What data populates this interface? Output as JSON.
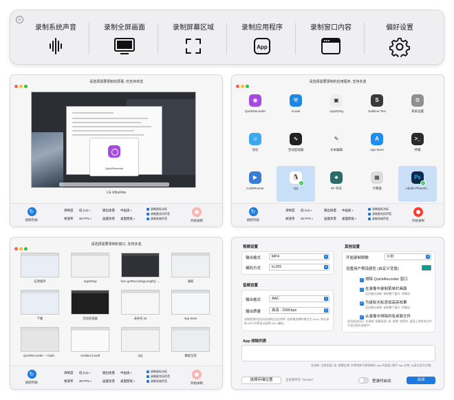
{
  "toolbar": {
    "items": [
      {
        "label": "录制系统声音",
        "icon": "waveform-icon"
      },
      {
        "label": "录制全屏画面",
        "icon": "monitor-icon"
      },
      {
        "label": "录制屏幕区域",
        "icon": "crop-frame-icon"
      },
      {
        "label": "录制应用程序",
        "icon": "app-icon",
        "icon_text": "App"
      },
      {
        "label": "录制窗口内容",
        "icon": "window-icon"
      },
      {
        "label": "偏好设置",
        "icon": "gear-icon"
      }
    ]
  },
  "controls": {
    "refresh": "刷新列表",
    "res_label": "清晰度",
    "res_value": "低 (1x)",
    "fps_label": "帧速率",
    "fps_value": "30 FPS",
    "quality_label": "输出质量",
    "quality_value": "中画质",
    "format_label": "画面背景",
    "format_value": "桌面壁纸",
    "checks": [
      "录制鼠标光标",
      "录制麦克风声音",
      "录制系统声音"
    ],
    "record": "开始录制"
  },
  "screen_window": {
    "title": "请选择需要录制的屏幕, 仅支持单选",
    "screen_name": "LG UltraFine",
    "app_name": "QuickRecorder"
  },
  "app_window": {
    "title": "请选择需要录制的应用程序, 支持多选",
    "apps": [
      {
        "name": "QuickRecorder",
        "color": "#a64be0",
        "glyph": "◉"
      },
      {
        "name": "Xcode",
        "color": "#1e88e5",
        "glyph": "⚒"
      },
      {
        "name": "App2Dmg",
        "color": "#eeeeee",
        "glyph": "▣"
      },
      {
        "name": "Sublime Text",
        "color": "#3a3a3a",
        "glyph": "S"
      },
      {
        "name": "系统设置",
        "color": "#8e8e93",
        "glyph": "⚙"
      },
      {
        "name": "访达",
        "color": "#3ba8f0",
        "glyph": "☺"
      },
      {
        "name": "活动监视器",
        "color": "#222222",
        "glyph": "∿"
      },
      {
        "name": "文本编辑",
        "color": "#f5f5f5",
        "glyph": "✎"
      },
      {
        "name": "App Store",
        "color": "#1f8cf0",
        "glyph": "A"
      },
      {
        "name": "终端",
        "color": "#2b2b2b",
        "glyph": ">_"
      },
      {
        "name": "CodeRunner",
        "color": "#3a7bd5",
        "glyph": "▶"
      },
      {
        "name": "QQ",
        "color": "#ffffff",
        "glyph": "🐧"
      },
      {
        "name": "SF 符号",
        "color": "#2d6a6a",
        "glyph": "♣"
      },
      {
        "name": "计算器",
        "color": "#dcdcdc",
        "glyph": "▦"
      },
      {
        "name": "Adobe Photosh...",
        "color": "#0b2a4a",
        "glyph": "Ps"
      }
    ]
  },
  "window_window": {
    "title": "请选择需要录制的窗口, 支持多选",
    "windows": [
      {
        "name": "应用程序"
      },
      {
        "name": "App2Dmg"
      },
      {
        "name": "func getRecordingLength() -..."
      },
      {
        "name": "通知"
      },
      {
        "name": "下载"
      },
      {
        "name": "活动监视器"
      },
      {
        "name": "未命名.txt"
      },
      {
        "name": "App Store"
      },
      {
        "name": "QuickRecorder — build..."
      },
      {
        "name": "Untitled 3.swift"
      },
      {
        "name": "QQ"
      },
      {
        "name": "模板全部"
      }
    ]
  },
  "settings": {
    "video_title": "视频设置",
    "output_format_label": "输出格式",
    "output_format_value": "MP4",
    "encoder_label": "编码方式",
    "encoder_value": "H.265",
    "audio_title": "音频设置",
    "audio_format_label": "输出格式",
    "audio_format_value": "AAC",
    "audio_quality_label": "输出质量",
    "audio_quality_value": "高清 - 256Kbps",
    "audio_hint": "录制视频时会自动选择适当比特率, 但如果选择的格式为 Opus, 则在录制 MP4 时将自动选择 AAC 编码。",
    "other_title": "其他设置",
    "countdown_label": "开始录制倒数",
    "countdown_value": "0 秒",
    "bg_color_label": "设置用户预设颜色 (自定义背景)",
    "exclude_self": "排除 QuickRecorder 窗口",
    "show_menubar": "在录像中录制菜单栏画面",
    "show_menubar_hint": "这仅能在录制 \"录制整个窗口\" 的情况",
    "hide_highlight": "为鼠标光标添加高亮效果",
    "hide_highlight_hint": "这仅能在录制 \"录制整个窗口\" 的情况",
    "hide_desktop": "从录像中排除所有桌面文件",
    "hide_desktop_hint": "启用此选项后, 在录制 \"屏幕画面\" 或 \"录制\" 程序时, 桌面上的所有文件不会出现在录像中。",
    "exclude_title": "App 排除列表",
    "exclude_hint": "在录制 \"全屏画面\" 或 \"屏幕区域\" 时将排除不想录制的 App 的画面 (填写 App 名称, 以英文逗号分隔)",
    "save_btn": "选择存储位置",
    "save_path": "当前保存在 \"Movies\"",
    "launch_login": "登录时启动",
    "close_btn": "关闭"
  },
  "colors": {
    "accent": "#1f7ae0",
    "record": "#ff3b30",
    "swatch": "#0a9c8e"
  }
}
